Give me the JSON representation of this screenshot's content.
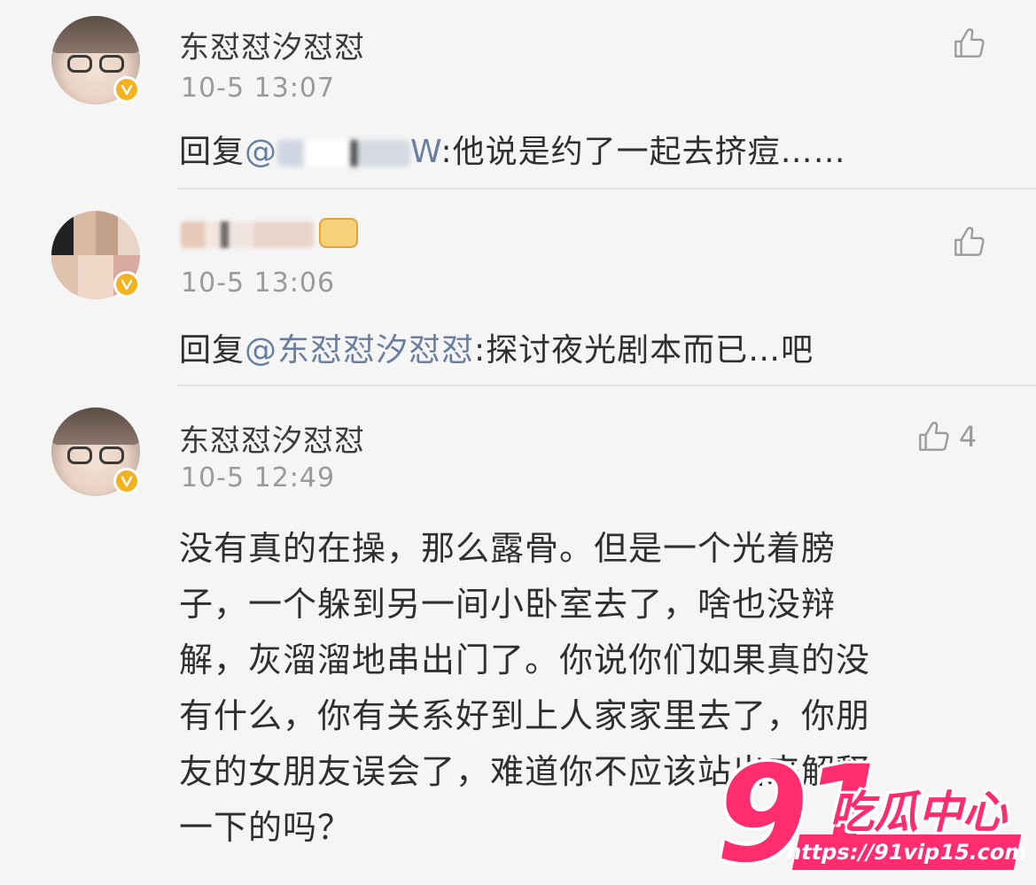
{
  "comments": [
    {
      "username": "东怼怼汐怼怼",
      "timestamp": "10-5 13:07",
      "reply_prefix": "回复",
      "mention": "@",
      "mention_tail": "W",
      "reply_text": ":他说是约了一起去挤痘……",
      "likes": ""
    },
    {
      "username": "",
      "timestamp": "10-5 13:06",
      "reply_prefix": "回复",
      "mention": "@东怼怼汐怼怼",
      "reply_text": ":探讨夜光剧本而已…吧",
      "likes": ""
    },
    {
      "username": "东怼怼汐怼怼",
      "timestamp": "10-5 12:49",
      "lines": [
        "没有真的在操，那么露骨。但是一个光着膀",
        "子，一个躲到另一间小卧室去了，啥也没辩",
        "解，灰溜溜地串出门了。你说你们如果真的没",
        "有什么，你有关系好到上人家家里去了，你朋",
        "友的女朋友误会了，难道你不应该站出来解释",
        "一下的吗？"
      ],
      "likes": "4"
    }
  ],
  "watermark": {
    "number": "91",
    "title": "吃瓜中心",
    "url": "https://91vip15.com"
  },
  "icons": {
    "like": "thumbs-up-icon",
    "verified": "verified-badge-icon"
  },
  "colors": {
    "mention": "#6a7fa0",
    "timestamp": "#9a9a9a",
    "watermark": "#ff2d6f",
    "verified": "#f4b120"
  }
}
